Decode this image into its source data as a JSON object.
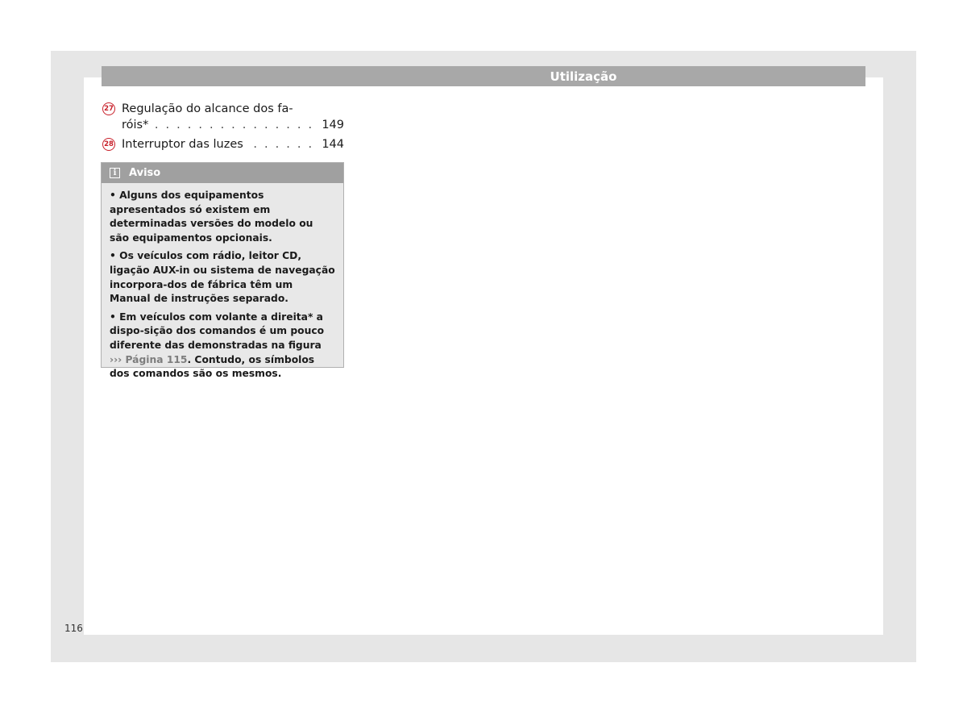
{
  "header": {
    "title": "Utilização"
  },
  "toc": [
    {
      "number": "27",
      "line1": "Regulação do alcance dos fa-",
      "line2": "róis*",
      "page": "149"
    },
    {
      "number": "28",
      "line1": "Interruptor das luzes",
      "page": "144"
    }
  ],
  "notice": {
    "icon": "info-icon",
    "title": "Aviso",
    "p1": "• Alguns dos equipamentos apresentados só existem em determinadas versões do modelo ou são equipamentos opcionais.",
    "p2": "• Os veículos com rádio, leitor CD, ligação AUX-in ou sistema de navegação incorpora-dos de fábrica têm um Manual de instruções separado.",
    "p3_before": "• Em veículos com volante a direita* a dispo-sição dos comandos é um pouco diferente das demonstradas na figura",
    "p3_link": "››› Página 115",
    "p3_after": ". Contudo, os símbolos dos comandos são os mesmos."
  },
  "page_number": "116",
  "colors": {
    "frame": "#e6e6e6",
    "header": "#a8a8a8",
    "accent": "#c8202a",
    "notice_bg": "#e8e8e8"
  }
}
